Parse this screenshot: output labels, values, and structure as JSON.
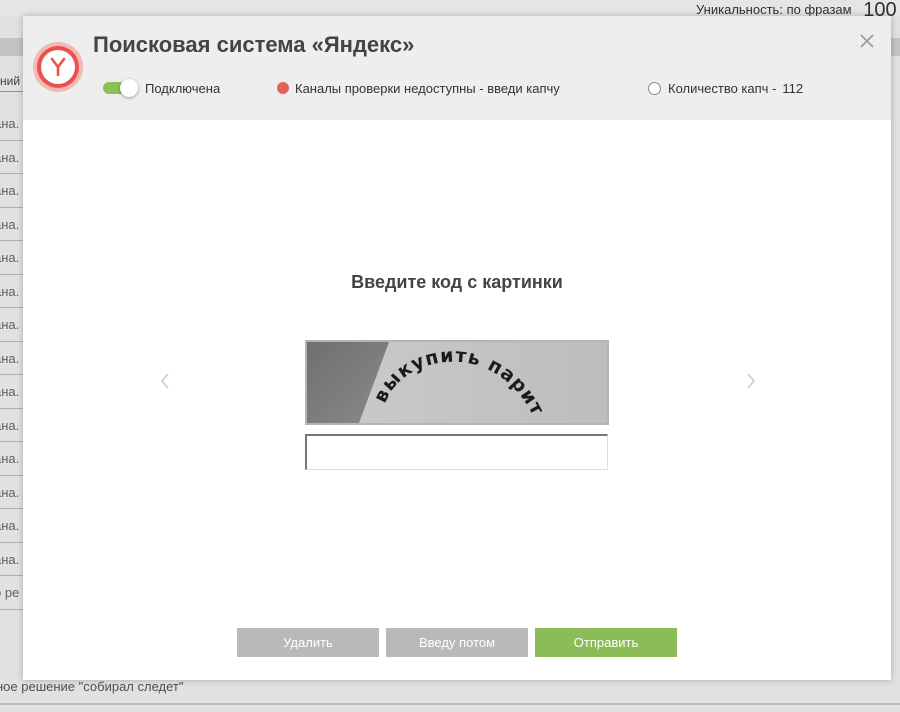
{
  "background": {
    "uniqueness_label": "Уникальность:",
    "phrases_label": "по фразам",
    "uniqueness_value": "100",
    "column_header": "ний",
    "row_text": "ана.",
    "row_count": 15,
    "last_row_text": "о ре",
    "bottom_text": "ное решение \"собирал следет\""
  },
  "modal": {
    "title": "Поисковая система «Яндекс»",
    "logo_icon": "yandex-logo-icon",
    "close_icon": "close-icon",
    "status": {
      "connection_label": "Подключена",
      "connection_on": true,
      "channels_label": "Каналы проверки недоступны - введи капчу",
      "channels_color": "#e2625e",
      "captcha_count_label": "Количество капч -",
      "captcha_count_value": "112"
    },
    "heading": "Введите код с картинки",
    "captcha_image_text": "выкупить парит",
    "captcha_input": {
      "value": "",
      "placeholder": ""
    },
    "buttons": {
      "delete_label": "Удалить",
      "later_label": "Введу потом",
      "send_label": "Отправить"
    },
    "nav": {
      "prev_icon": "chevron-left-icon",
      "next_icon": "chevron-right-icon"
    },
    "colors": {
      "accent": "#8cbc58",
      "disabled": "#b9b9b9",
      "header_bg": "#eeeeee"
    }
  }
}
